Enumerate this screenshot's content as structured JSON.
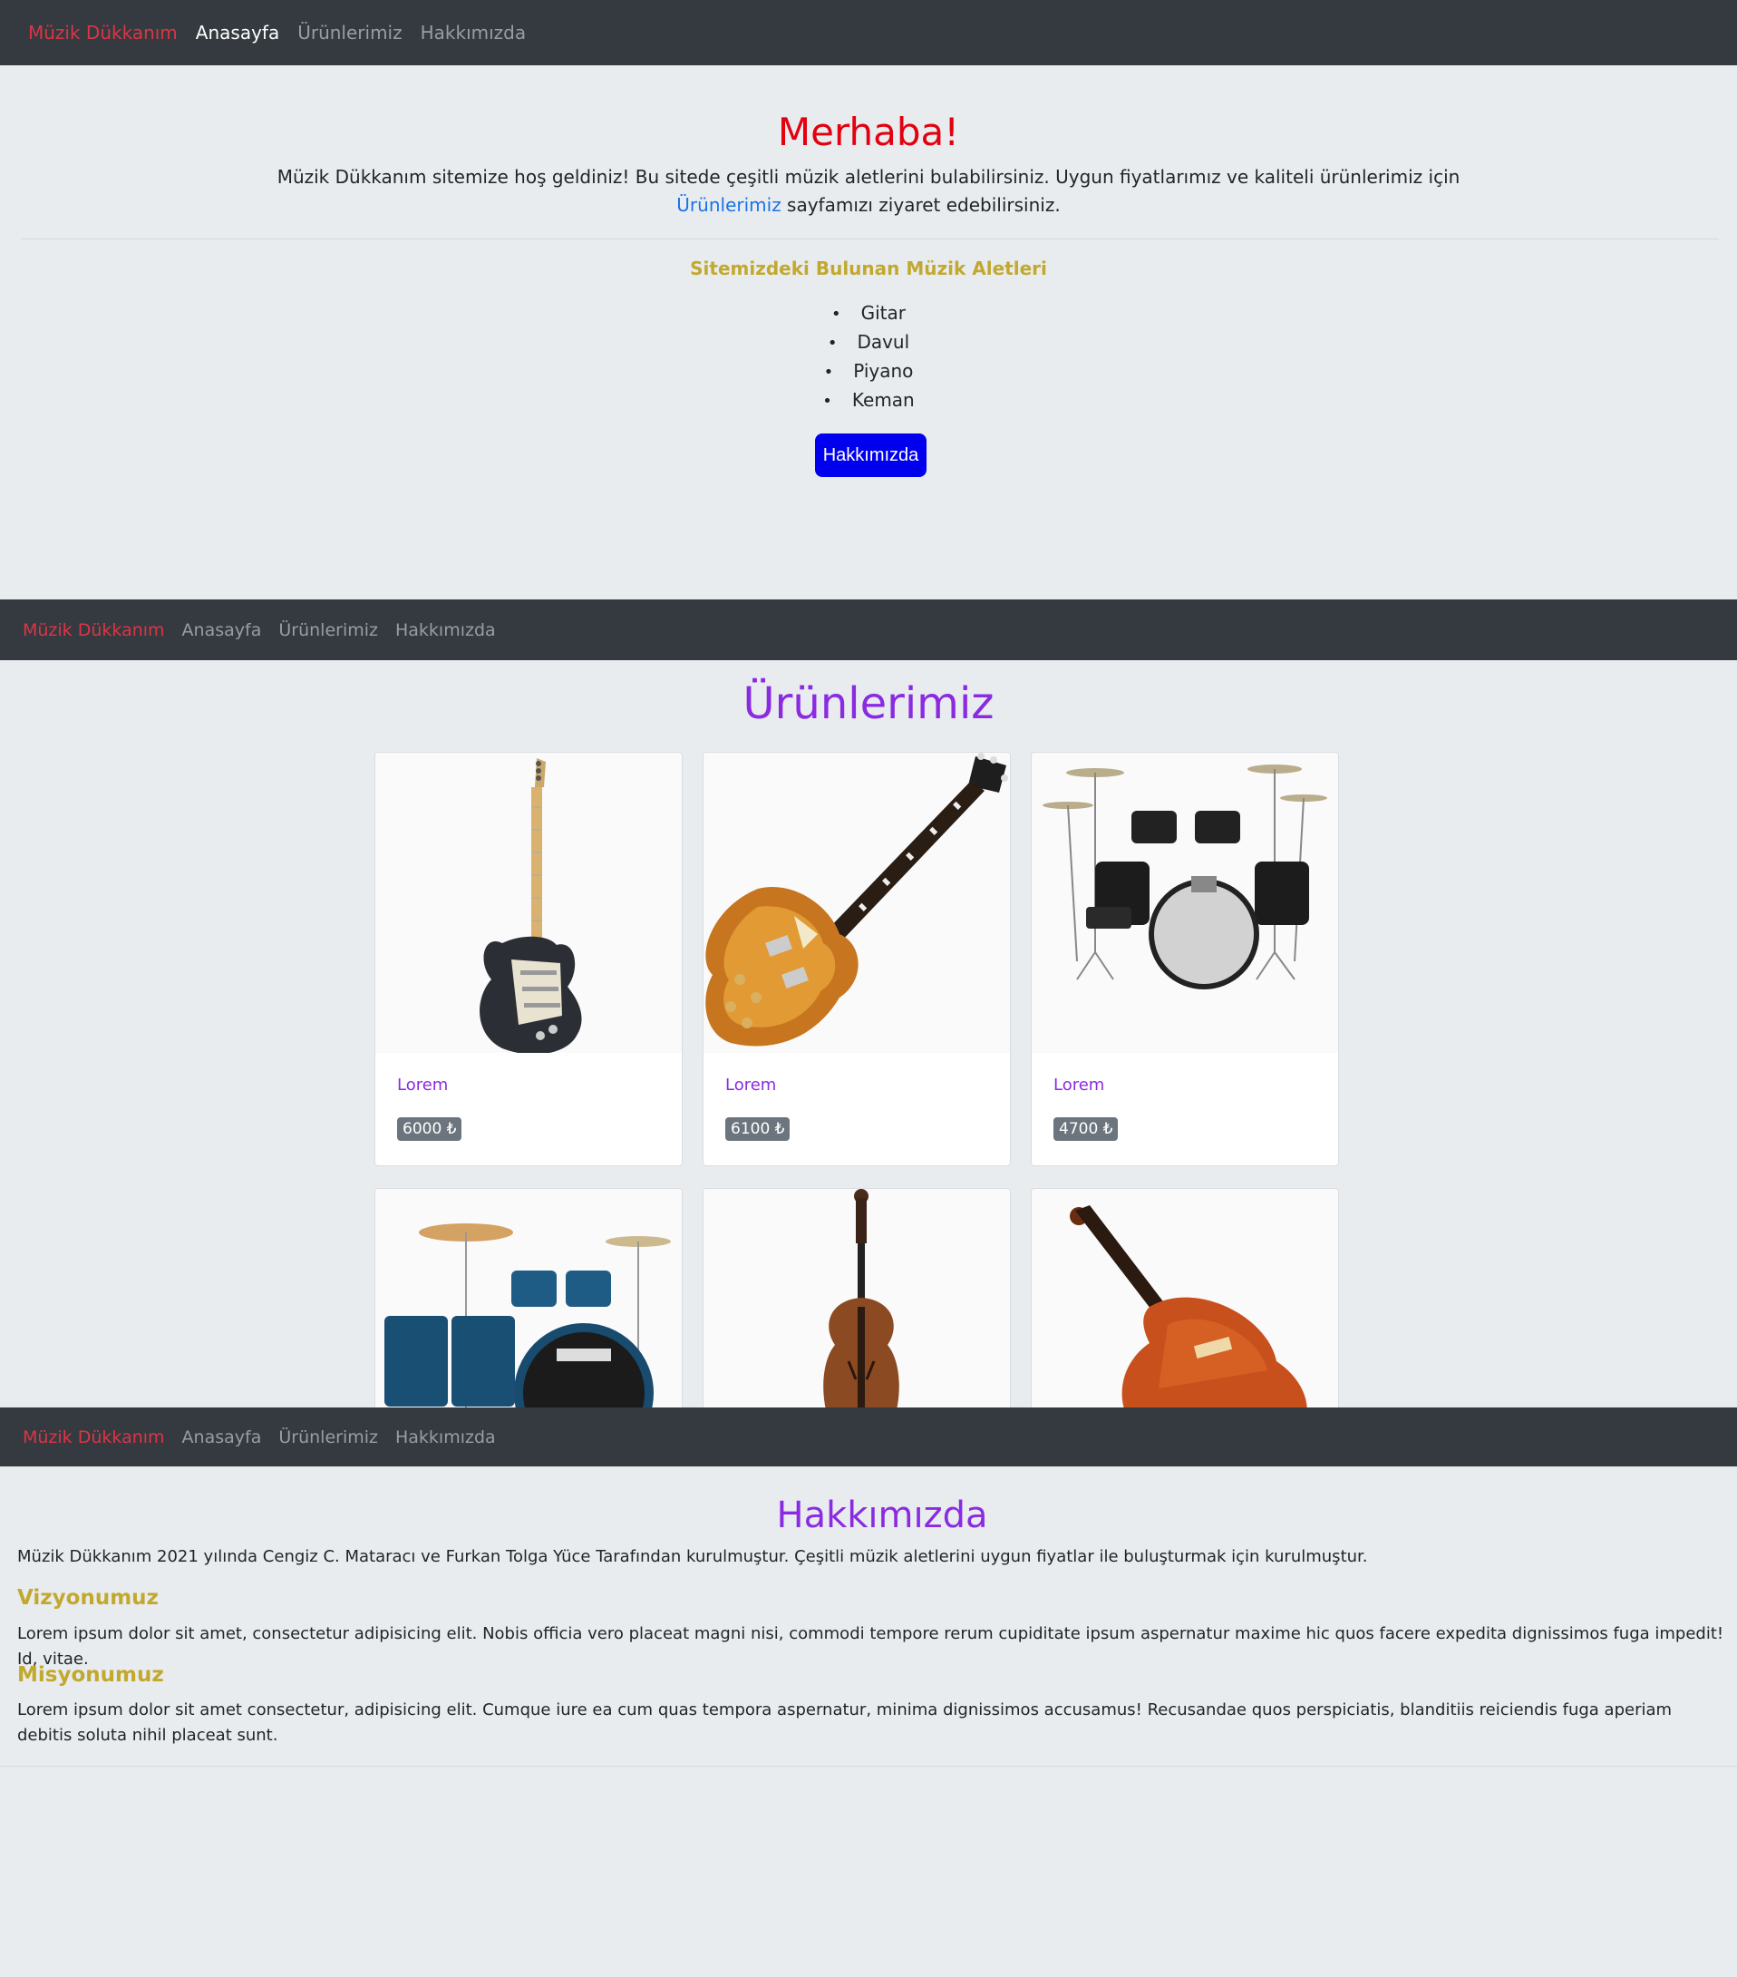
{
  "nav": {
    "brand": "Müzik Dükkanım",
    "home": "Anasayfa",
    "products": "Ürünlerimiz",
    "about": "Hakkımızda"
  },
  "hero": {
    "title": "Merhaba!",
    "text_before": "Müzik Dükkanım sitemize hoş geldiniz! Bu sitede çeşitli müzik aletlerini bulabilirsiniz. Uygun fiyatlarımız ve kaliteli ürünlerimiz için ",
    "link": "Ürünlerimiz",
    "text_after": " sayfamızı ziyaret edebilirsiniz.",
    "subheading": "Sitemizdeki Bulunan Müzik Aletleri",
    "instruments": [
      "Gitar",
      "Davul",
      "Piyano",
      "Keman"
    ],
    "button": "Hakkımızda"
  },
  "products": {
    "title": "Ürünlerimiz",
    "items": [
      {
        "name": "Lorem",
        "price": "6000 ₺",
        "icon": "electric-guitar-image"
      },
      {
        "name": "Lorem",
        "price": "6100 ₺",
        "icon": "les-paul-guitar-image"
      },
      {
        "name": "Lorem",
        "price": "4700 ₺",
        "icon": "drum-kit-image"
      },
      {
        "name": "",
        "price": "",
        "icon": "tama-drum-kit-image"
      },
      {
        "name": "",
        "price": "",
        "icon": "violin-image"
      },
      {
        "name": "",
        "price": "",
        "icon": "violin-closeup-image"
      }
    ]
  },
  "about": {
    "title": "Hakkımızda",
    "intro": "Müzik Dükkanım 2021 yılında Cengiz C. Mataracı ve Furkan Tolga Yüce Tarafından kurulmuştur. Çeşitli müzik aletlerini uygun fiyatlar ile buluşturmak için kurulmuştur.",
    "vision_title": "Vizyonumuz",
    "vision_text": "Lorem ipsum dolor sit amet, consectetur adipisicing elit. Nobis officia vero placeat magni nisi, commodi tempore rerum cupiditate ipsum aspernatur maxime hic quos facere expedita dignissimos fuga impedit! Id, vitae.",
    "mission_title": "Misyonumuz",
    "mission_text": "Lorem ipsum dolor sit amet consectetur, adipisicing elit. Cumque iure ea cum quas tempora aspernatur, minima dignissimos accusamus! Recusandae quos perspiciatis, blanditiis reiciendis fuga aperiam debitis soluta nihil placeat sunt."
  },
  "colors": {
    "navbar": "#343a40",
    "brand": "#dc3545",
    "hero_title": "#e3000f",
    "accent_purple": "#8a2be2",
    "accent_gold": "#c1a92f",
    "button": "#0000ee"
  }
}
